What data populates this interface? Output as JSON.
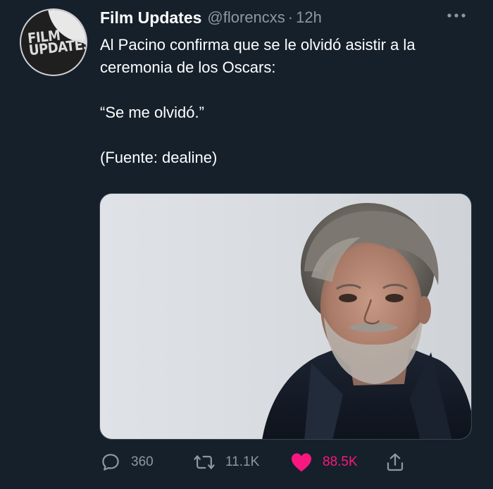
{
  "tweet": {
    "author_name": "Film Updates",
    "handle": "@florencxs",
    "separator": "·",
    "time": "12h",
    "avatar_text_line1": "FILM",
    "avatar_text_line2": "UPDATES",
    "text_line1": "Al Pacino confirma que se le olvidó asistir a la ceremonia de los Oscars:",
    "text_quote": "“Se me olvidó.”",
    "text_source": "(Fuente: dealine)"
  },
  "actions": {
    "reply_count": "360",
    "retweet_count": "11.1K",
    "like_count": "88.5K"
  },
  "icons": {
    "more": "more-dots-icon",
    "reply": "reply-icon",
    "retweet": "retweet-icon",
    "like": "heart-icon",
    "share": "share-icon"
  },
  "colors": {
    "background": "#15202b",
    "secondary_text": "#8b98a5",
    "like_active": "#f91880"
  }
}
